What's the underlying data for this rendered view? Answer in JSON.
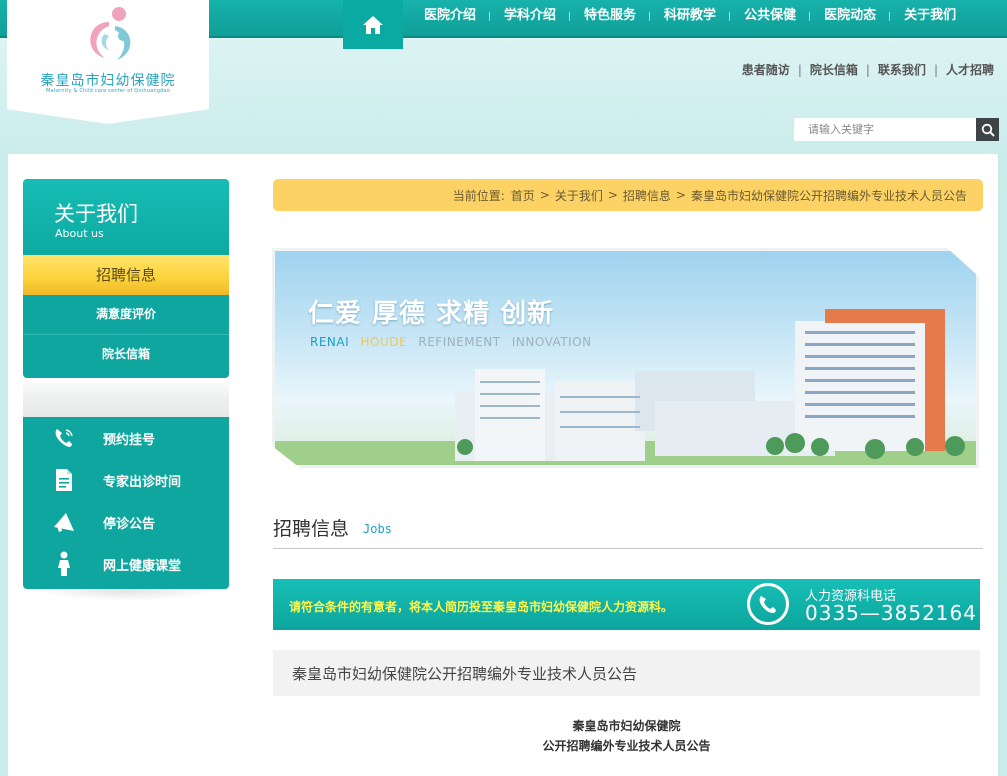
{
  "header": {
    "logo_cn": "秦皇岛市妇幼保健院",
    "logo_en": "Maternity & Child care center of Qinhuangdao",
    "nav": [
      "医院介绍",
      "学科介绍",
      "特色服务",
      "科研教学",
      "公共保健",
      "医院动态",
      "关于我们"
    ],
    "sublinks": [
      "患者随访",
      "院长信箱",
      "联系我们",
      "人才招聘"
    ],
    "search_placeholder": "请输入关键字"
  },
  "sidebar": {
    "title": "关于我们",
    "subtitle": "About us",
    "active_item": "招聘信息",
    "sub_items": [
      "满意度评价",
      "院长信箱"
    ],
    "links": [
      {
        "label": "预约挂号",
        "icon": "phone-icon"
      },
      {
        "label": "专家出诊时间",
        "icon": "document-icon"
      },
      {
        "label": "停诊公告",
        "icon": "megaphone-icon"
      },
      {
        "label": "网上健康课堂",
        "icon": "person-icon"
      }
    ]
  },
  "breadcrumb": {
    "prefix": "当前位置:",
    "items": [
      "首页",
      "关于我们",
      "招聘信息",
      "秦皇岛市妇幼保健院公开招聘编外专业技术人员公告"
    ],
    "separator": ">"
  },
  "banner": {
    "slogan": "仁爱 厚德 求精 创新",
    "en_words": [
      "RENAI",
      "HOUDE",
      "REFINEMENT",
      "INNOVATION"
    ],
    "en_colors": [
      "#1a9fc7",
      "#f2c94c",
      "#9fb1bb",
      "#9fb1bb"
    ]
  },
  "section": {
    "title": "招聘信息",
    "subtitle": "Jobs"
  },
  "notice": {
    "text": "请符合条件的有意者，将本人简历投至秦皇岛市妇幼保健院人力资源科。",
    "phone_label": "人力资源科电话",
    "phone_number": "0335—3852164"
  },
  "article": {
    "title": "秦皇岛市妇幼保健院公开招聘编外专业技术人员公告",
    "head_line1": "秦皇岛市妇幼保健院",
    "head_line2": "公开招聘编外专业技术人员公告"
  },
  "colors": {
    "primary_teal": "#0fa69f",
    "accent_yellow": "#fcd265",
    "notice_text": "#fff54a"
  }
}
